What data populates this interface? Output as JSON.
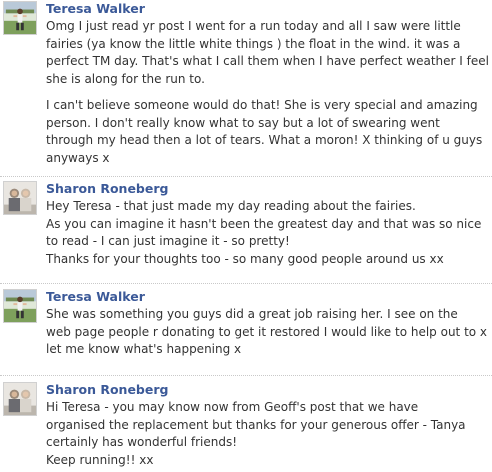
{
  "posts": [
    {
      "author": "Teresa Walker",
      "avatar_icon": "runner-avatar-icon",
      "paragraphs": [
        "Omg I just read yr post I went for a run today and all I saw were little\nfairies (ya know the little white things ) the float in the wind. it was a\nperfect TM day. That's what I call them when I have perfect weather I feel\nshe is along for the run to.",
        "I can't believe someone would do that! She is very special and amazing\nperson. I don't really know what to say but a lot of swearing went\nthrough my head then a lot of tears. What a moron! X thinking of u guys\nanyways x"
      ]
    },
    {
      "author": "Sharon Roneberg",
      "avatar_icon": "couple-avatar-icon",
      "paragraphs": [
        "Hey Teresa - that just made  my day reading about the fairies.\nAs you can imagine it hasn't been the greatest day and that was so nice\nto read - I can just imagine it - so pretty!\nThanks for your thoughts too - so many good people around us xx"
      ]
    },
    {
      "author": "Teresa Walker",
      "avatar_icon": "runner-avatar-icon",
      "paragraphs": [
        "She was something you guys did a great job raising her. I see on the\nweb page people r donating to get it restored I would like to help out to x\nlet me know what's happening x"
      ]
    },
    {
      "author": "Sharon Roneberg",
      "avatar_icon": "couple-avatar-icon",
      "paragraphs": [
        "Hi Teresa - you may know now  from Geoff's post that we have\norganised the replacement but thanks for your generous offer - Tanya\ncertainly has wonderful friends!\nKeep running!! xx"
      ]
    }
  ],
  "colors": {
    "author_link": "#3b5998",
    "body_text": "#333333",
    "divider": "#c9c9c9"
  }
}
